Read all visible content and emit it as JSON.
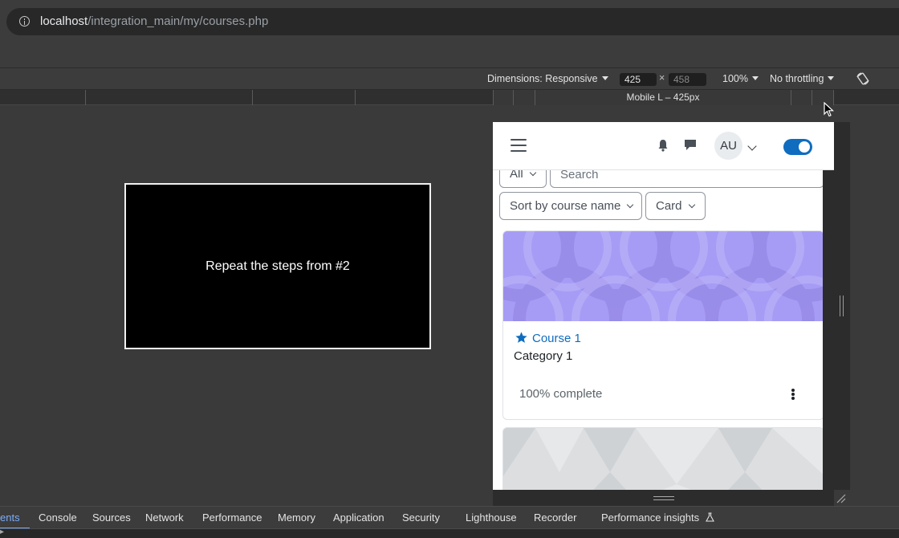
{
  "browser": {
    "url_host": "localhost",
    "url_path": "/integration_main/my/courses.php"
  },
  "device_toolbar": {
    "dimensions_label": "Dimensions: Responsive",
    "width": "425",
    "separator": "×",
    "height": "458",
    "zoom": "100%",
    "throttling": "No throttling"
  },
  "ruler": {
    "device_label": "Mobile L – 425px"
  },
  "video": {
    "caption": "Repeat the steps from #2"
  },
  "mobile": {
    "avatar_initials": "AU",
    "filter_all": "All",
    "search_placeholder": "Search",
    "sort_label": "Sort by course name",
    "view_label": "Card",
    "course": {
      "title": "Course 1",
      "category": "Category 1",
      "progress_text": "100% complete"
    },
    "colors": {
      "brand": "#0f6cbf",
      "card_image": "#a79cf5"
    }
  },
  "devtools": {
    "tabs": [
      "ents",
      "Console",
      "Sources",
      "Network",
      "Performance",
      "Memory",
      "Application",
      "Security",
      "Lighthouse",
      "Recorder",
      "Performance insights"
    ],
    "active_tab": "ents",
    "bottom_text": "▸"
  }
}
